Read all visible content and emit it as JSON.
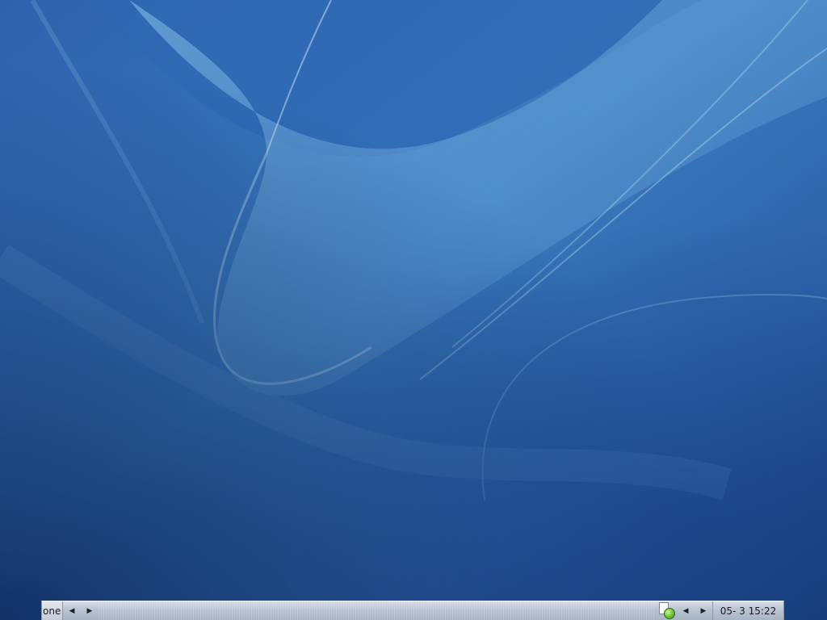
{
  "desktop": {
    "background_color": "#2f63a8"
  },
  "taskbar": {
    "pager_label": "one",
    "left_prev_arrow": "◀",
    "left_next_arrow": "▶",
    "tray_prev_arrow": "◀",
    "tray_next_arrow": "▶",
    "clock": "05- 3 15:22",
    "tray_icons": [
      "document-icon",
      "green-status-icon"
    ]
  }
}
